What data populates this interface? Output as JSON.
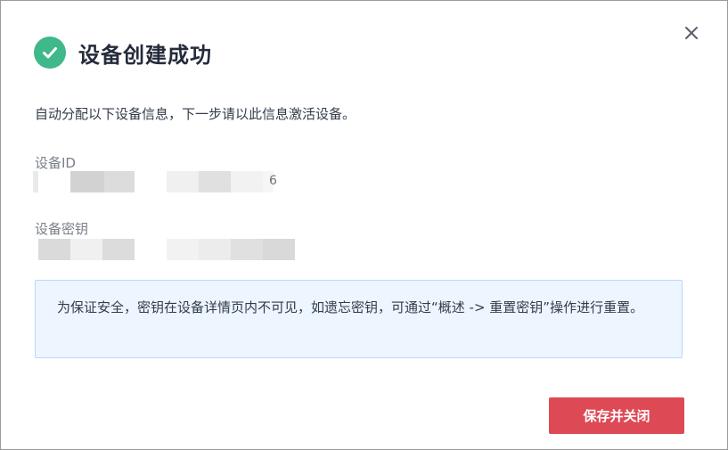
{
  "dialog": {
    "title": "设备创建成功",
    "description": "自动分配以下设备信息，下一步请以此信息激活设备。",
    "device_id_label": "设备ID",
    "device_id_visible_tail": "6",
    "device_secret_label": "设备密钥",
    "notice": "为保证安全，密钥在设备详情页内不可见，如遗忘密钥，可通过“概述 -> 重置密钥”操作进行重置。",
    "save_button_label": "保存并关闭"
  },
  "colors": {
    "success": "#3fb88a",
    "primary_button": "#dd4a55",
    "notice_bg": "#edf5ff",
    "notice_border": "#b9d7ff"
  },
  "icons": {
    "title_icon": "check-circle-icon",
    "close": "close-icon"
  }
}
